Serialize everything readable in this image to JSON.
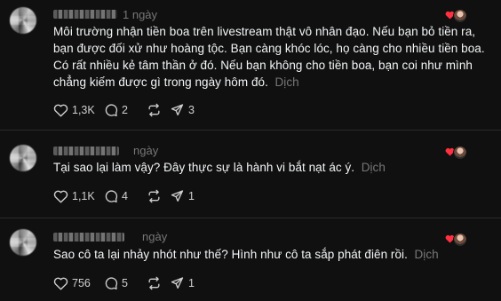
{
  "posts": [
    {
      "time": "1 ngày",
      "text": "Môi trường nhận tiền boa trên livestream thật vô nhân đạo. Nếu bạn bỏ tiền ra, bạn được đối xử như hoàng tộc. Bạn càng khóc lóc, họ càng cho nhiều tiền boa. Có rất nhiều kẻ tâm thần ở đó. Nếu bạn không cho tiền boa, bạn coi như mình chẳng kiếm được gì trong ngày hôm đó.",
      "translate": "Dịch",
      "likes": "1,3K",
      "comments": "2",
      "reposts": "",
      "shares": "3"
    },
    {
      "time": "ngày",
      "text": "Tại sao lại làm vậy? Đây thực sự là hành vi bắt nạt ác ý.",
      "translate": "Dịch",
      "likes": "1,1K",
      "comments": "4",
      "reposts": "",
      "shares": "1"
    },
    {
      "time": "ngày",
      "text": "Sao cô ta lại nhảy nhót như thế? Hình như cô ta sắp phát điên rồi.",
      "translate": "Dịch",
      "likes": "756",
      "comments": "5",
      "reposts": "",
      "shares": "1"
    }
  ],
  "colors": {
    "background": "#101010",
    "text": "#f3f5f7",
    "muted": "#777777",
    "heart": "#ff3040"
  },
  "icons": [
    "heart-icon",
    "comment-icon",
    "repost-icon",
    "share-icon"
  ]
}
